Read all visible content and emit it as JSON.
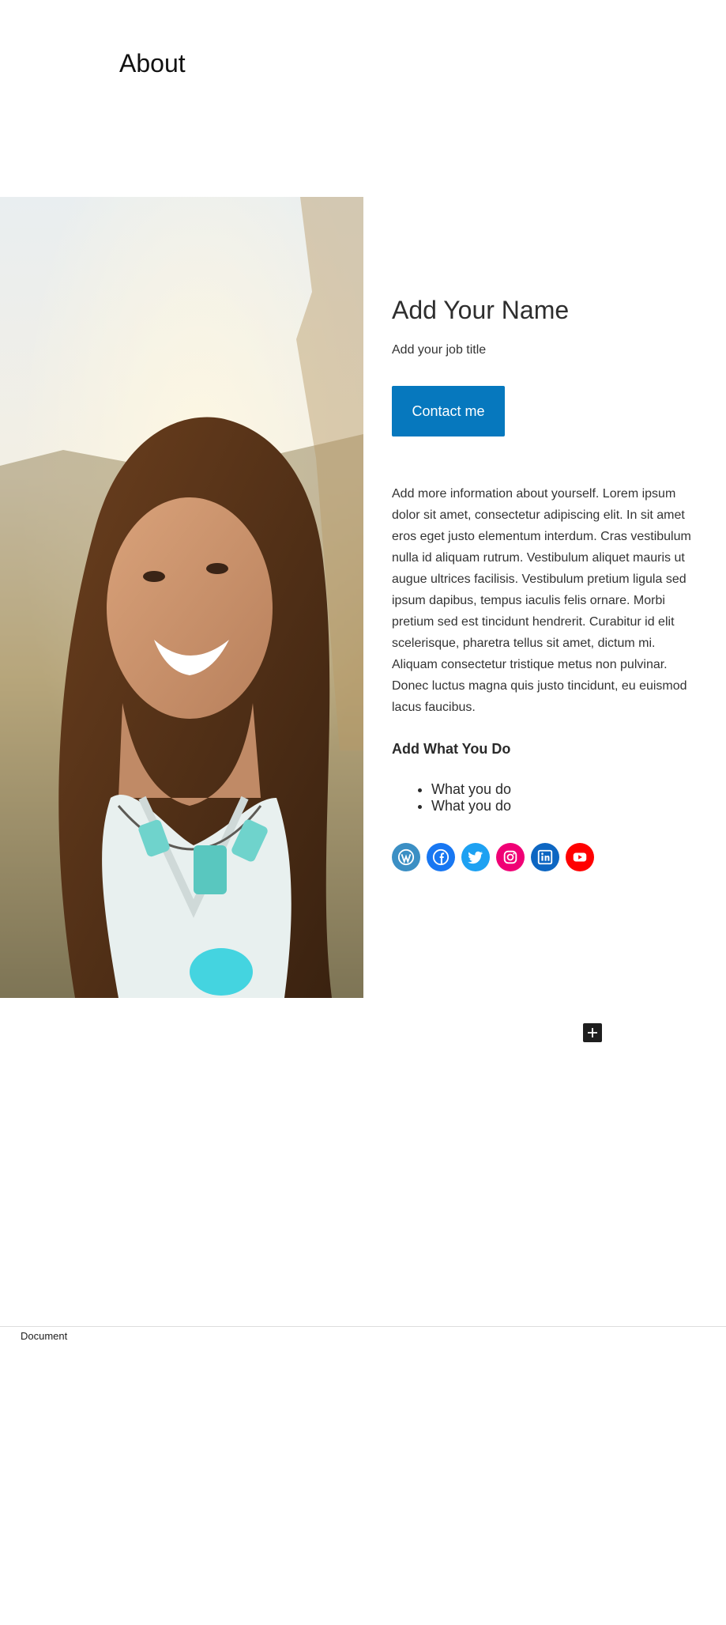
{
  "page": {
    "title": "About"
  },
  "profile": {
    "name": "Add Your Name",
    "job_title": "Add your job title",
    "contact_label": "Contact me",
    "bio": "Add more information about yourself. Lorem ipsum dolor sit amet, consectetur adipiscing elit. In sit amet eros eget justo elementum interdum. Cras vestibulum nulla id aliquam rutrum. Vestibulum aliquet mauris ut augue ultrices facilisis. Vestibulum pretium ligula sed ipsum dapibus, tempus iaculis felis ornare. Morbi pretium sed est tincidunt hendrerit. Curabitur id elit scelerisque, pharetra tellus sit amet, dictum mi. Aliquam consectetur tristique metus non pulvinar. Donec luctus magna quis justo tincidunt, eu euismod lacus faucibus.",
    "photo_icon": "portrait-photo"
  },
  "skills": {
    "heading": "Add What You Do",
    "items": [
      "What you do",
      "What you do"
    ]
  },
  "social": [
    {
      "name": "wordpress-icon",
      "color": "#3b8fc4"
    },
    {
      "name": "facebook-icon",
      "color": "#1877f2"
    },
    {
      "name": "twitter-icon",
      "color": "#1da1f2"
    },
    {
      "name": "instagram-icon",
      "color": "#f00075"
    },
    {
      "name": "linkedin-icon",
      "color": "#0d66c2"
    },
    {
      "name": "youtube-icon",
      "color": "#ff0000"
    }
  ],
  "editor": {
    "add_block_icon": "plus-icon",
    "breadcrumb": "Document"
  }
}
